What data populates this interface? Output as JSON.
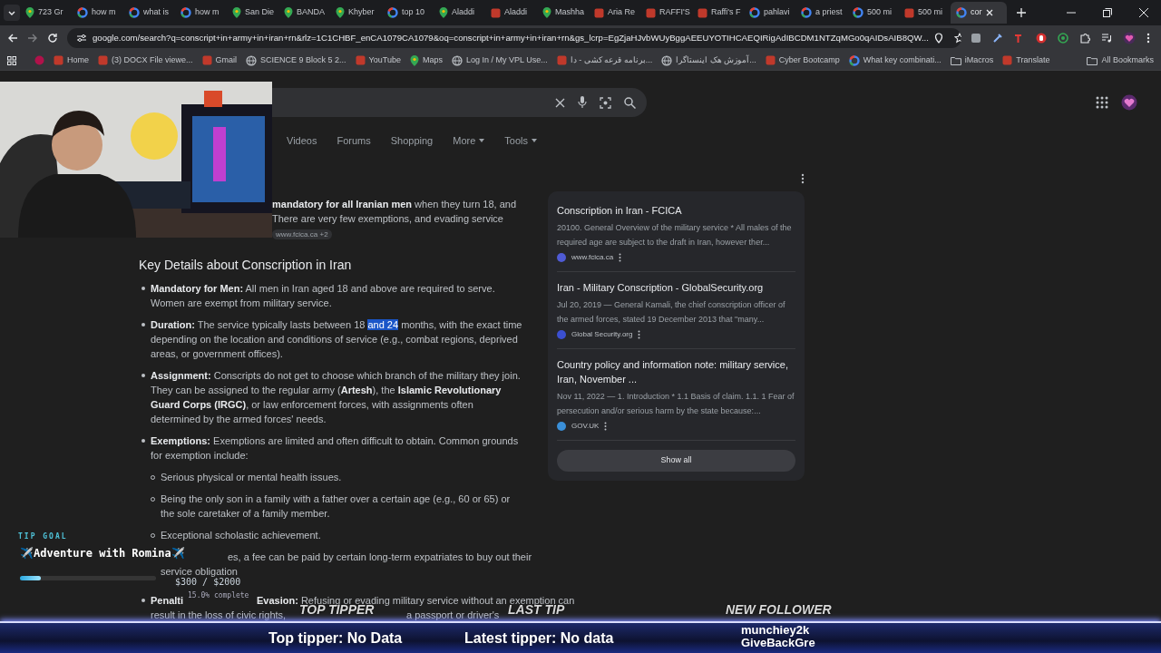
{
  "browser": {
    "tabs": [
      {
        "label": "723 Gr",
        "kind": "pin",
        "selected": false
      },
      {
        "label": "how m",
        "kind": "ring",
        "selected": false
      },
      {
        "label": "what is",
        "kind": "ring",
        "selected": false
      },
      {
        "label": "how m",
        "kind": "ring",
        "selected": false
      },
      {
        "label": "San Die",
        "kind": "pin",
        "selected": false
      },
      {
        "label": "BANDA",
        "kind": "pin",
        "selected": false
      },
      {
        "label": "Khyber",
        "kind": "pin",
        "selected": false
      },
      {
        "label": "top 10",
        "kind": "ring",
        "selected": false
      },
      {
        "label": "Aladdi",
        "kind": "pin",
        "selected": false
      },
      {
        "label": "Aladdi",
        "kind": "site",
        "selected": false
      },
      {
        "label": "Mashha",
        "kind": "pin",
        "selected": false
      },
      {
        "label": "Aria Re",
        "kind": "site",
        "selected": false
      },
      {
        "label": "RAFFI'S",
        "kind": "site",
        "selected": false
      },
      {
        "label": "Raffi's F",
        "kind": "site",
        "selected": false
      },
      {
        "label": "pahlavi",
        "kind": "ring",
        "selected": false
      },
      {
        "label": "a priest",
        "kind": "ring",
        "selected": false
      },
      {
        "label": "500 mi",
        "kind": "ring",
        "selected": false
      },
      {
        "label": "500 mi",
        "kind": "site",
        "selected": false
      },
      {
        "label": "cor",
        "kind": "ring",
        "selected": true
      }
    ],
    "url": "google.com/search?q=conscript+in+army+in+iran+rn&rlz=1C1CHBF_enCA1079CA1079&oq=conscript+in+army+in+iran+rn&gs_lcrp=EgZjaHJvbWUyBggAEEUYOTIHCAEQIRigAdIBCDM1NTZqMGo0qAIDsAIB8QW...",
    "bookmarks": [
      {
        "label": "Home",
        "kind": "site"
      },
      {
        "label": "(3) DOCX File viewe...",
        "kind": "site"
      },
      {
        "label": "Gmail",
        "kind": "site"
      },
      {
        "label": "SCIENCE 9 Block 5 2...",
        "kind": "globe"
      },
      {
        "label": "YouTube",
        "kind": "site"
      },
      {
        "label": "Maps",
        "kind": "pin"
      },
      {
        "label": "Log In / My VPL Use...",
        "kind": "globe"
      },
      {
        "label": "برنامه قرعه کشی - دا...",
        "kind": "site"
      },
      {
        "label": "آموزش هک اینستاگرا...",
        "kind": "globe"
      },
      {
        "label": "Cyber Bootcamp",
        "kind": "site"
      },
      {
        "label": "What key combinati...",
        "kind": "ring"
      },
      {
        "label": "iMacros",
        "kind": "folder"
      },
      {
        "label": "Translate",
        "kind": "site"
      }
    ],
    "all_bookmarks": "All Bookmarks"
  },
  "search": {
    "nav": [
      {
        "label": "Videos",
        "kind": "link"
      },
      {
        "label": "Forums",
        "kind": "link"
      },
      {
        "label": "Shopping",
        "kind": "link"
      },
      {
        "label": "More",
        "kind": "menu"
      },
      {
        "label": "Tools",
        "kind": "menu"
      }
    ]
  },
  "answer": {
    "snippet_lines": [
      "**mandatory for all Iranian men** when they turn 18, and",
      "There are very few exemptions, and evading service"
    ],
    "source": "www.fcica.ca +2",
    "heading": "Key Details about Conscription in Iran",
    "items": [
      {
        "kind": "text",
        "lead": "Mandatory for Men:",
        "parts": [
          {
            "text": " All men in Iran aged 18 and above are required to serve. Women are exempt from military service.",
            "selected": false
          }
        ]
      },
      {
        "kind": "text",
        "lead": "Duration:",
        "parts": [
          {
            "text": " The service typically lasts between 18 ",
            "selected": false
          },
          {
            "text": "and 24",
            "selected": true
          },
          {
            "text": " months, with the exact time depending on the location and conditions of service (e.g., combat regions, deprived areas, or government offices).",
            "selected": false
          }
        ]
      },
      {
        "kind": "text",
        "lead": "Assignment:",
        "parts": [
          {
            "text": " Conscripts do not get to choose which branch of the military they join. They can be assigned to the regular army (**Artesh**), the **Islamic Revolutionary Guard Corps (IRGC)**, or law enforcement forces, with assignments often determined by the armed forces' needs.",
            "selected": false
          }
        ]
      },
      {
        "kind": "text",
        "lead": "Exemptions:",
        "parts": [
          {
            "text": " Exemptions are limited and often difficult to obtain. Common grounds for exemption include:",
            "selected": false
          }
        ],
        "children": [
          {
            "kind": "text",
            "text": "Serious physical or mental health issues."
          },
          {
            "kind": "text",
            "text": "Being the only son in a family with a father over a certain age (e.g., 60 or 65) or the sole caretaker of a family member."
          },
          {
            "kind": "text",
            "text": "Exceptional scholastic achievement."
          },
          {
            "kind": "fragments",
            "fragments": [
              "es, a fee can be paid by certain long-term expatriates to buy out their",
              "service obligation"
            ]
          }
        ]
      },
      {
        "kind": "fragments",
        "fragments": [
          "**Penalti**",
          "**Evasion:** Refusing or evading military service without an exemption can",
          "result in the loss of civic rights,",
          "a passport or driver's"
        ]
      }
    ]
  },
  "sources": {
    "items": [
      {
        "title": "Conscription in Iran - FCICA",
        "snippet": "20100. General Overview of the military service * All males of the required age are subject to the draft in Iran, however ther...",
        "site": "www.fcica.ca",
        "color": "#4f5bd5"
      },
      {
        "title": "Iran - Military Conscription - GlobalSecurity.org",
        "snippet": "Jul 20, 2019 — General Kamali, the chief conscription officer of the armed forces, stated 19 December 2013 that \"many...",
        "site": "Global Security.org",
        "color": "#3b4fd0"
      },
      {
        "title": "Country policy and information note: military service, Iran, November ...",
        "snippet": "Nov 11, 2022 — 1. Introduction * 1.1 Basis of claim. 1.1. 1 Fear of persecution and/or serious harm by the state because:...",
        "site": "GOV.UK",
        "color": "#3a8fd8"
      }
    ],
    "button": "Show all"
  },
  "overlay": {
    "tip_goal": {
      "label": "TIP GOAL",
      "title": "✈️Adventure with Romina✈️",
      "level": 0.15,
      "amount": "$300 / $2000",
      "percent": "15.0% complete"
    },
    "labels": [
      "TOP TIPPER",
      "LAST TIP",
      "NEW FOLLOWER"
    ],
    "top_tipper": "Top tipper: No Data",
    "latest_tipper": "Latest tipper: No data",
    "followers": [
      "munchiey2k",
      "GiveBackGre"
    ]
  }
}
